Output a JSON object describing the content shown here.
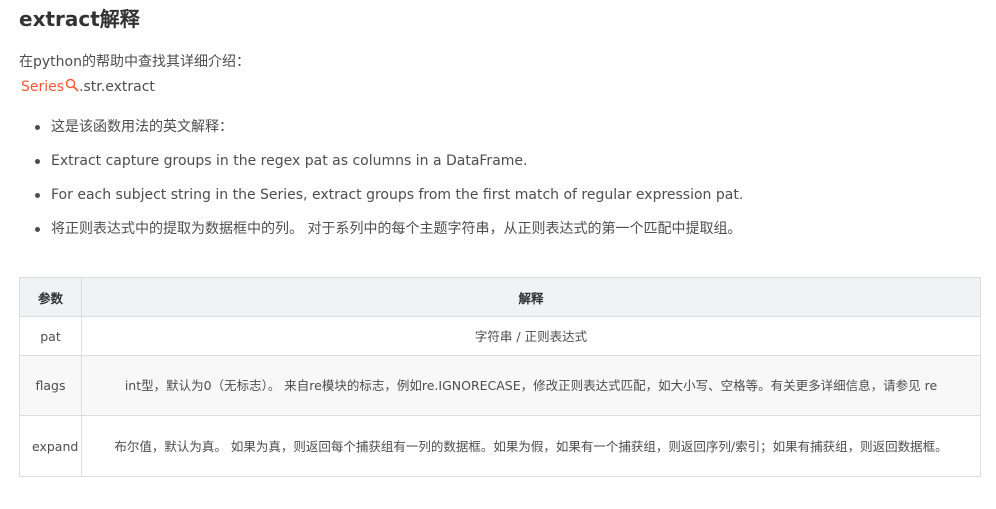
{
  "heading": "extract解释",
  "intro": "在python的帮助中查找其详细介绍：",
  "reference": {
    "link_text": "Series",
    "link_icon": "search-icon",
    "rest": ".str.extract"
  },
  "bullets": [
    "这是该函数用法的英文解释：",
    "Extract capture groups in the regex pat as columns in a DataFrame.",
    "For each subject string in the Series, extract groups from the first match of regular expression pat.",
    "将正则表达式中的提取为数据框中的列。 对于系列中的每个主题字符串，从正则表达式的第一个匹配中提取组。"
  ],
  "table": {
    "headers": [
      "参数",
      "解释"
    ],
    "rows": [
      {
        "param": "pat",
        "desc": "字符串 / 正则表达式"
      },
      {
        "param": "flags",
        "desc": "int型，默认为0（无标志）。 来自re模块的标志，例如re.IGNORECASE，修改正则表达式匹配，如大小写、空格等。有关更多详细信息，请参见 re"
      },
      {
        "param": "expand",
        "desc": "布尔值，默认为真。 如果为真，则返回每个捕获组有一列的数据框。如果为假，如果有一个捕获组，则返回序列/索引；如果有捕获组，则返回数据框。"
      }
    ]
  },
  "colors": {
    "link": "#fc5531",
    "text": "#4d4d4d",
    "header_bg": "#eff3f5",
    "alt_row_bg": "#f8f8f8"
  }
}
